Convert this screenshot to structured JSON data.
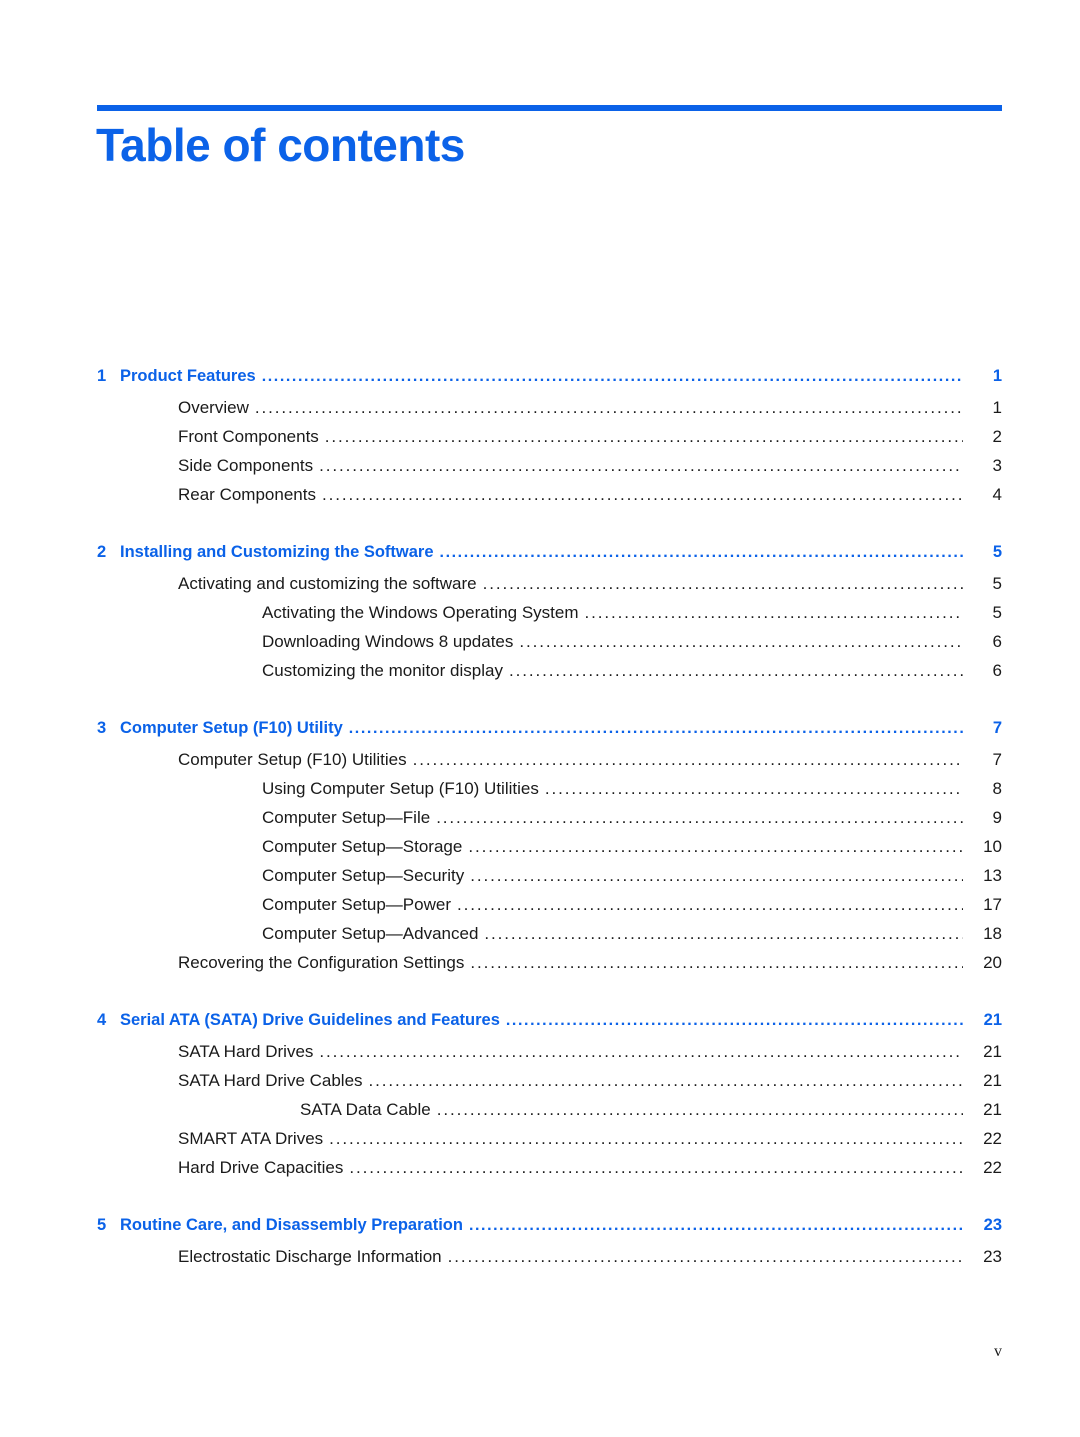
{
  "document": {
    "title": "Table of contents",
    "accent_color": "#0b62e8",
    "text_color": "#1a1a1a",
    "folio": "v"
  },
  "toc": {
    "rows": [
      {
        "kind": "chapter",
        "number": "1",
        "label": "Product Features",
        "page": "1",
        "level": 0
      },
      {
        "kind": "entry",
        "number": "",
        "label": "Overview",
        "page": "1",
        "level": 1
      },
      {
        "kind": "entry",
        "number": "",
        "label": "Front Components",
        "page": "2",
        "level": 1
      },
      {
        "kind": "entry",
        "number": "",
        "label": "Side Components",
        "page": "3",
        "level": 1
      },
      {
        "kind": "entry",
        "number": "",
        "label": "Rear Components",
        "page": "4",
        "level": 1
      },
      {
        "kind": "chapter",
        "number": "2",
        "label": "Installing and Customizing the Software",
        "page": "5",
        "level": 0
      },
      {
        "kind": "entry",
        "number": "",
        "label": "Activating and customizing the software",
        "page": "5",
        "level": 1
      },
      {
        "kind": "entry",
        "number": "",
        "label": "Activating the Windows Operating System",
        "page": "5",
        "level": 2
      },
      {
        "kind": "entry",
        "number": "",
        "label": "Downloading Windows 8 updates",
        "page": "6",
        "level": 2
      },
      {
        "kind": "entry",
        "number": "",
        "label": "Customizing the monitor display",
        "page": "6",
        "level": 2
      },
      {
        "kind": "chapter",
        "number": "3",
        "label": "Computer Setup (F10) Utility",
        "page": "7",
        "level": 0
      },
      {
        "kind": "entry",
        "number": "",
        "label": "Computer Setup (F10) Utilities",
        "page": "7",
        "level": 1
      },
      {
        "kind": "entry",
        "number": "",
        "label": "Using Computer Setup (F10) Utilities",
        "page": "8",
        "level": 2
      },
      {
        "kind": "entry",
        "number": "",
        "label": "Computer Setup—File",
        "page": "9",
        "level": 2
      },
      {
        "kind": "entry",
        "number": "",
        "label": "Computer Setup—Storage",
        "page": "10",
        "level": 2
      },
      {
        "kind": "entry",
        "number": "",
        "label": "Computer Setup—Security",
        "page": "13",
        "level": 2
      },
      {
        "kind": "entry",
        "number": "",
        "label": "Computer Setup—Power",
        "page": "17",
        "level": 2
      },
      {
        "kind": "entry",
        "number": "",
        "label": "Computer Setup—Advanced",
        "page": "18",
        "level": 2
      },
      {
        "kind": "entry",
        "number": "",
        "label": "Recovering the Configuration Settings",
        "page": "20",
        "level": 1
      },
      {
        "kind": "chapter",
        "number": "4",
        "label": "Serial ATA (SATA) Drive Guidelines and Features",
        "page": "21",
        "level": 0
      },
      {
        "kind": "entry",
        "number": "",
        "label": "SATA Hard Drives",
        "page": "21",
        "level": 1
      },
      {
        "kind": "entry",
        "number": "",
        "label": "SATA Hard Drive Cables",
        "page": "21",
        "level": 1
      },
      {
        "kind": "entry",
        "number": "",
        "label": "SATA Data Cable",
        "page": "21",
        "level": 3
      },
      {
        "kind": "entry",
        "number": "",
        "label": "SMART ATA Drives",
        "page": "22",
        "level": 1
      },
      {
        "kind": "entry",
        "number": "",
        "label": "Hard Drive Capacities",
        "page": "22",
        "level": 1
      },
      {
        "kind": "chapter",
        "number": "5",
        "label": "Routine Care, and Disassembly Preparation",
        "page": "23",
        "level": 0
      },
      {
        "kind": "entry",
        "number": "",
        "label": "Electrostatic Discharge Information",
        "page": "23",
        "level": 1
      }
    ]
  }
}
